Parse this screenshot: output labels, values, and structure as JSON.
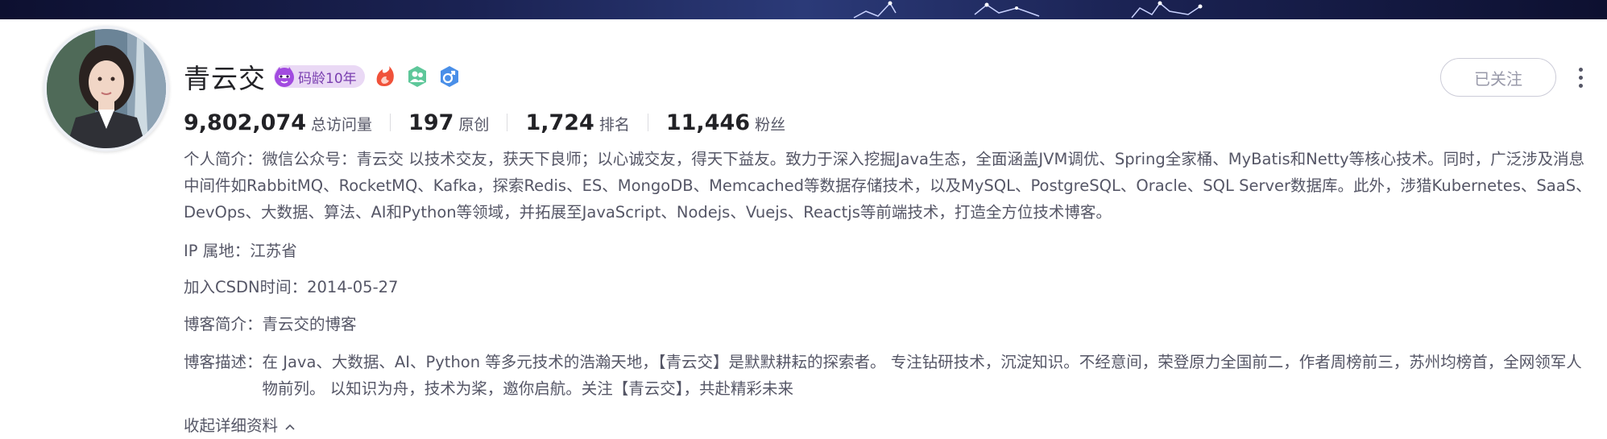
{
  "profile": {
    "name": "青云交",
    "code_age_badge": "码龄10年",
    "badges": [
      "imp-badge-icon",
      "flame-medal-icon",
      "people-medal-icon",
      "male-icon"
    ]
  },
  "stats": [
    {
      "value": "9,802,074",
      "label": "总访问量"
    },
    {
      "value": "197",
      "label": "原创"
    },
    {
      "value": "1,724",
      "label": "排名"
    },
    {
      "value": "11,446",
      "label": "粉丝"
    }
  ],
  "bio": {
    "label": "个人简介：",
    "text": "微信公众号：青云交 以技术交友，获天下良师；以心诚交友，得天下益友。致力于深入挖掘Java生态，全面涵盖JVM调优、Spring全家桶、MyBatis和Netty等核心技术。同时，广泛涉及消息中间件如RabbitMQ、RocketMQ、Kafka，探索Redis、ES、MongoDB、Memcached等数据存储技术，以及MySQL、PostgreSQL、Oracle、SQL Server数据库。此外，涉猎Kubernetes、SaaS、DevOps、大数据、算法、AI和Python等领域，并拓展至JavaScript、Nodejs、Vuejs、Reactjs等前端技术，打造全方位技术博客。"
  },
  "details": {
    "ip_label": "IP 属地：",
    "ip_value": "江苏省",
    "join_label": "加入CSDN时间：",
    "join_value": "2014-05-27",
    "blog_intro_label": "博客简介：",
    "blog_intro_value": "青云交的博客",
    "blog_desc_label": "博客描述：",
    "blog_desc_value": "在 Java、大数据、AI、Python 等多元技术的浩瀚天地，【青云交】是默默耕耘的探索者。 专注钻研技术，沉淀知识。不经意间，荣登原力全国前二，作者周榜前三，苏州均榜首，全网领军人物前列。 以知识为舟，技术为桨，邀你启航。关注【青云交】，共赴精彩未来",
    "collapse_label": "收起详细资料"
  },
  "actions": {
    "follow_label": "已关注"
  },
  "colors": {
    "text_primary": "#222226",
    "text_secondary": "#555666",
    "badge_bg": "#ead9f5",
    "badge_text": "#7a3fb0",
    "banner": "#1b2354"
  }
}
